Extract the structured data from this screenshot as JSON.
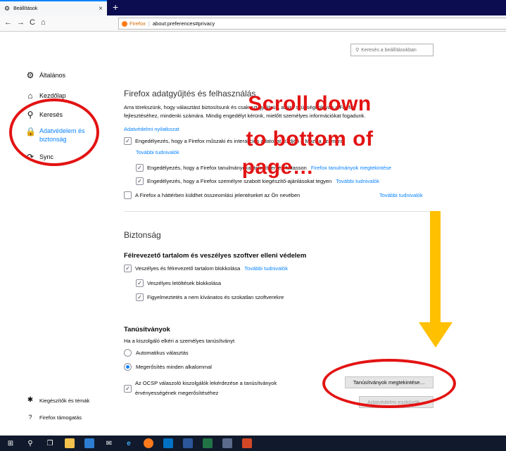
{
  "browser": {
    "tab_title": "Beállítások",
    "tab_close": "×",
    "new_tab": "+",
    "back": "←",
    "forward": "→",
    "reload": "C",
    "home": "⌂",
    "url_brand": "Firefox",
    "url_sep": "|",
    "url": "about:preferences#privacy"
  },
  "search": {
    "placeholder": "Keresés a beállításokban"
  },
  "sidebar": {
    "items": [
      {
        "label": "Általános",
        "icon": "gear-icon"
      },
      {
        "label": "Kezdőlap",
        "icon": "home-icon"
      },
      {
        "label": "Keresés",
        "icon": "search-icon"
      },
      {
        "label": "Adatvédelem és biztonság",
        "icon": "lock-icon",
        "active": true
      },
      {
        "label": "Sync",
        "icon": "sync-icon"
      }
    ],
    "footer": [
      {
        "label": "Kiegészítők és témák",
        "icon": "puzzle-icon"
      },
      {
        "label": "Firefox támogatás",
        "icon": "help-icon"
      }
    ]
  },
  "data_collection": {
    "title": "Firefox adatgyűjtés és felhasználás",
    "desc_line1": "Arra törekszünk, hogy választást biztosítsunk és csak azt gyűjtsük, amire szükségünk van a Firefox",
    "desc_line2": "fejlesztéséhez, mindenki számára. Mindig engedélyt kérünk, mielőtt személyes információkat fogadunk.",
    "privacy_link": "Adatvédelmi nyilatkozat",
    "opt1": "Engedélyezés, hogy a Firefox műszaki és interakciós adatokat küldjön a Mozilla számára",
    "opt1_link": "További tudnivalók",
    "opt2": "Engedélyezés, hogy a Firefox tanulmányokat telepítsen és futtasson",
    "opt2_link": "Firefox tanulmányok megtekintése",
    "opt3": "Engedélyezés, hogy a Firefox személyre szabott kiegészítő-ajánlásokat tegyen",
    "opt3_link": "További tudnivalók",
    "opt4": "A Firefox a háttérben küldhet összeomlási jelentéseket az Ön nevében",
    "opt4_link": "További tudnivalók"
  },
  "security": {
    "title": "Biztonság",
    "subtitle": "Félrevezető tartalom és veszélyes szoftver elleni védelem",
    "opt1": "Veszélyes és félrevezető tartalom blokkolása",
    "opt1_link": "További tudnivalók",
    "opt2": "Veszélyes letöltések blokkolása",
    "opt3": "Figyelmeztetés a nem kívánatos és szokatlan szoftverekre"
  },
  "certs": {
    "title": "Tanúsítványok",
    "prompt": "Ha a kiszolgáló elkéri a személyes tanúsítványt",
    "radio_auto": "Automatikus választás",
    "radio_ask": "Megerősítés minden alkalommal",
    "ocsp_line1": "Az OCSP válaszoló kiszolgálók lekérdezése a tanúsítványok",
    "ocsp_line2": "érvényességének megerősítéséhez",
    "view_button": "Tanúsítványok megtekintése…",
    "devices_button": "Adatvédelmi eszközök…"
  },
  "checkmark": "✓",
  "annotation": {
    "line1": "Scroll down",
    "line2": "to bottom of",
    "line3": "page…"
  },
  "colors": {
    "accent": "#0a84ff",
    "annotation_red": "#e31313",
    "arrow_yellow": "#ffc000",
    "taskbar": "#101a2c"
  },
  "taskbar": {
    "icons": [
      "windows-icon",
      "search-icon",
      "task-view-icon",
      "file-explorer-icon",
      "store-icon",
      "mail-icon",
      "edge-icon",
      "firefox-icon",
      "outlook-icon",
      "word-icon",
      "excel-icon",
      "calculator-icon",
      "powerpoint-icon"
    ]
  }
}
